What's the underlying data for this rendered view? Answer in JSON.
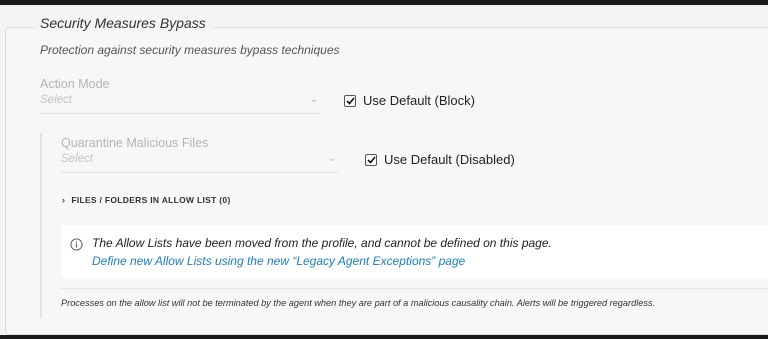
{
  "section": {
    "title": "Security Measures Bypass",
    "subtitle": "Protection against security measures bypass techniques"
  },
  "action_mode": {
    "label": "Action Mode",
    "select_placeholder": "Select",
    "use_default_label": "Use Default (Block)",
    "use_default_checked": true
  },
  "quarantine": {
    "label": "Quarantine Malicious Files",
    "select_placeholder": "Select",
    "use_default_label": "Use Default (Disabled)",
    "use_default_checked": true
  },
  "allow_list": {
    "label": "FILES / FOLDERS IN ALLOW LIST (0)"
  },
  "info": {
    "message": "The Allow Lists have been moved from the profile, and cannot be defined on this page.",
    "link": "Define new Allow Lists using the new “Legacy Agent Exceptions” page"
  },
  "footer_note": "Processes on the allow list will not be terminated by the agent when they are part of a malicious causality chain. Alerts will be triggered regardless.",
  "icons": {
    "chevron": "chevron-down-icon",
    "check": "checkmark-icon",
    "expand": "chevron-right-icon",
    "info": "info-circle-icon"
  },
  "colors": {
    "link": "#1b7ec2",
    "muted_label": "#b4b4b4"
  }
}
